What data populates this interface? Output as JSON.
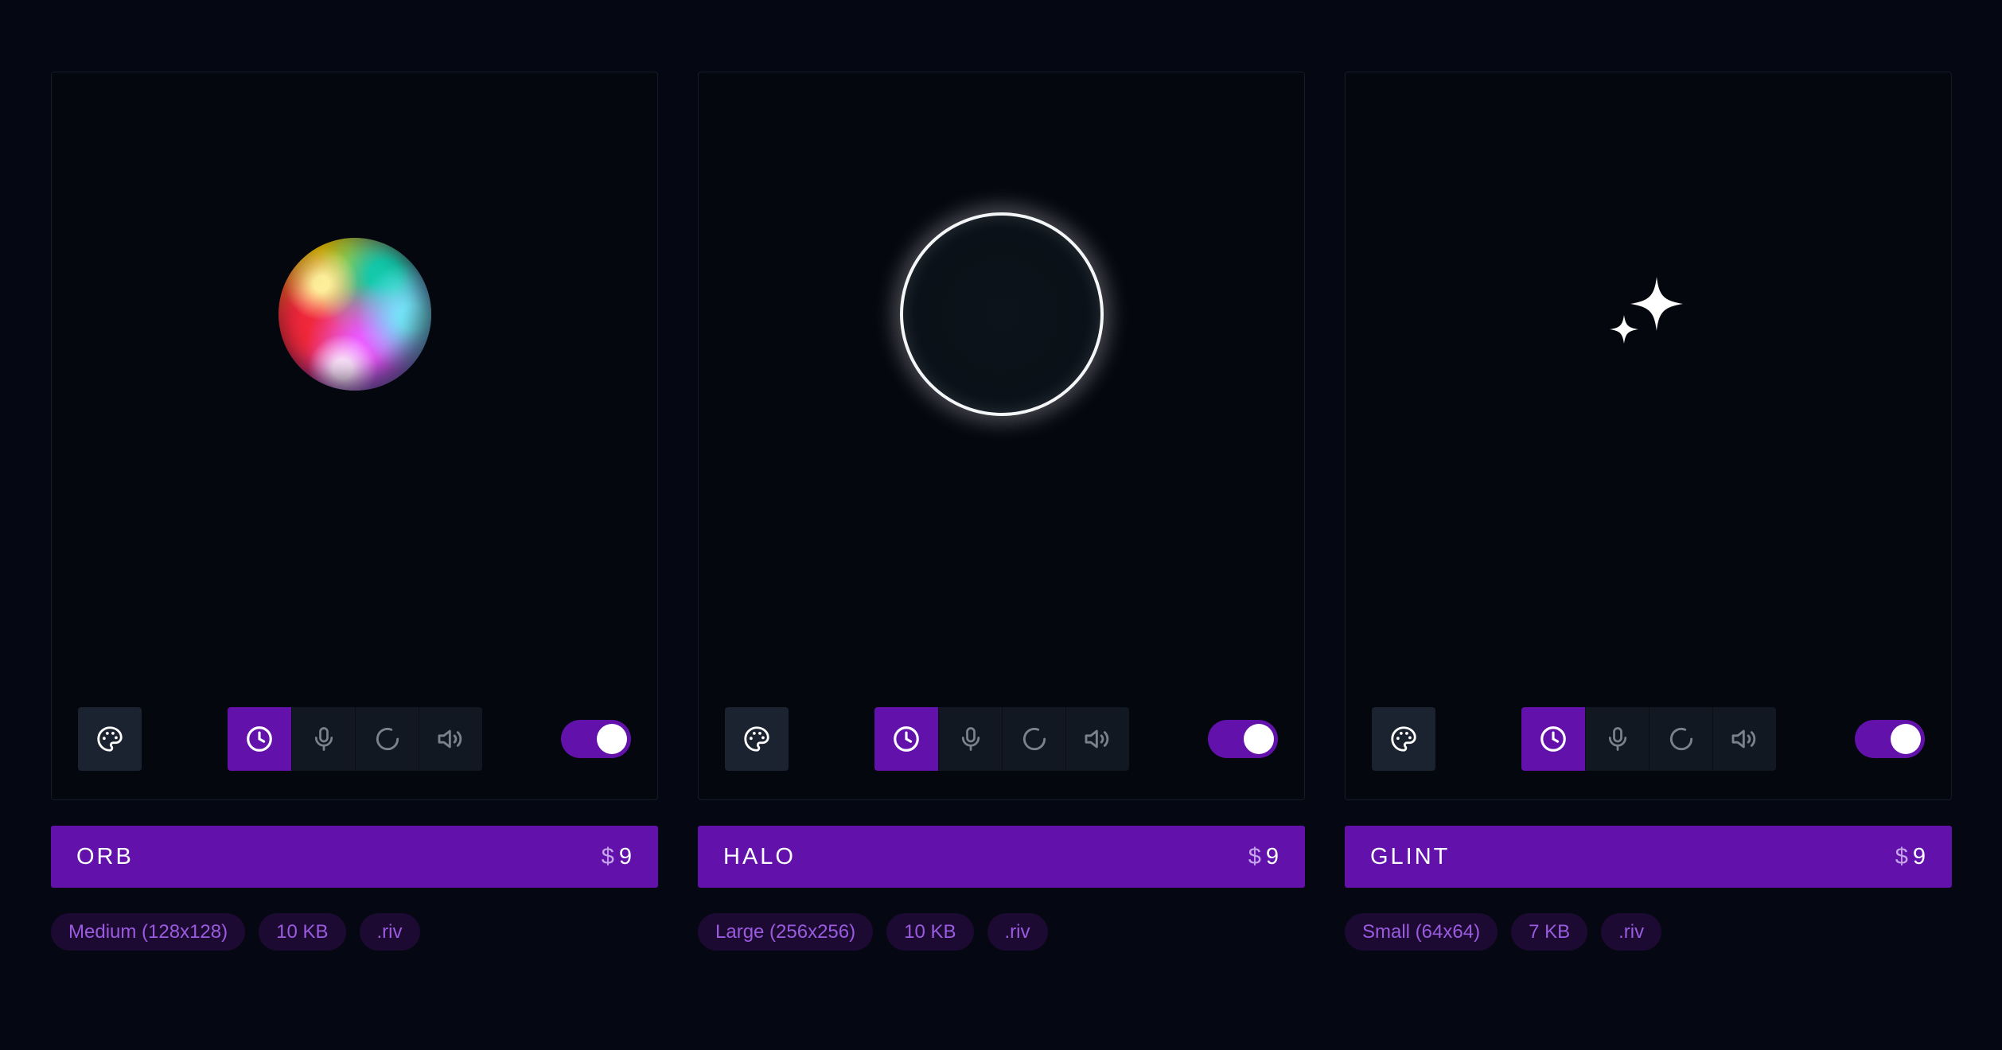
{
  "products": [
    {
      "name": "ORB",
      "price": {
        "currency": "$",
        "amount": "9"
      },
      "preview": "orb",
      "tags": [
        "Medium (128x128)",
        "10 KB",
        ".riv"
      ],
      "toggle_on": true,
      "active_mode": "clock"
    },
    {
      "name": "HALO",
      "price": {
        "currency": "$",
        "amount": "9"
      },
      "preview": "halo-ring",
      "tags": [
        "Large (256x256)",
        "10 KB",
        ".riv"
      ],
      "toggle_on": true,
      "active_mode": "clock"
    },
    {
      "name": "GLINT",
      "price": {
        "currency": "$",
        "amount": "9"
      },
      "preview": "sparkle",
      "tags": [
        "Small (64x64)",
        "7 KB",
        ".riv"
      ],
      "toggle_on": true,
      "active_mode": "clock"
    }
  ],
  "controls": {
    "palette": "palette-icon",
    "modes": [
      "clock-icon",
      "microphone-icon",
      "loading-spinner-icon",
      "speaker-icon"
    ]
  },
  "colors": {
    "background": "#050812",
    "card_border": "#151b27",
    "accent": "#6211ab",
    "button_bg": "#1b2330",
    "segment_bg": "#121822",
    "tag_bg": "#1d0a32",
    "tag_text": "#9a5be0"
  }
}
